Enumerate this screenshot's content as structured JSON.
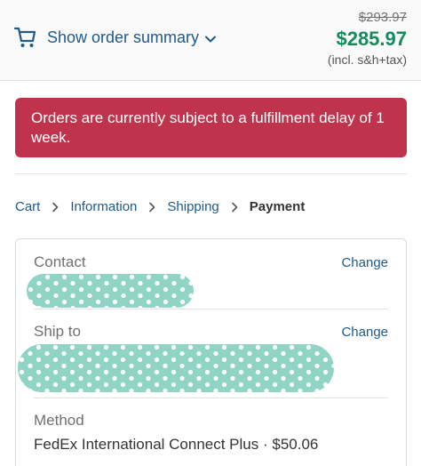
{
  "order_summary": {
    "toggle_label": "Show order summary",
    "icon": "cart-icon",
    "old_price": "$293.97",
    "total_price": "$285.97",
    "price_note": "(incl. s&h+tax)"
  },
  "alert": {
    "text": "Orders are currently subject to a fulfillment delay of 1 week."
  },
  "breadcrumb": {
    "items": [
      "Cart",
      "Information",
      "Shipping",
      "Payment"
    ],
    "current": "Payment"
  },
  "review": {
    "contact": {
      "label": "Contact",
      "change": "Change"
    },
    "ship_to": {
      "label": "Ship to",
      "change": "Change"
    },
    "method": {
      "label": "Method",
      "value": "FedEx International Connect Plus · $50.06"
    }
  },
  "colors": {
    "link": "#1e5a8a",
    "price_green": "#178a5b",
    "alert_bg": "#c0334d",
    "redaction": "#8fd4c5"
  }
}
